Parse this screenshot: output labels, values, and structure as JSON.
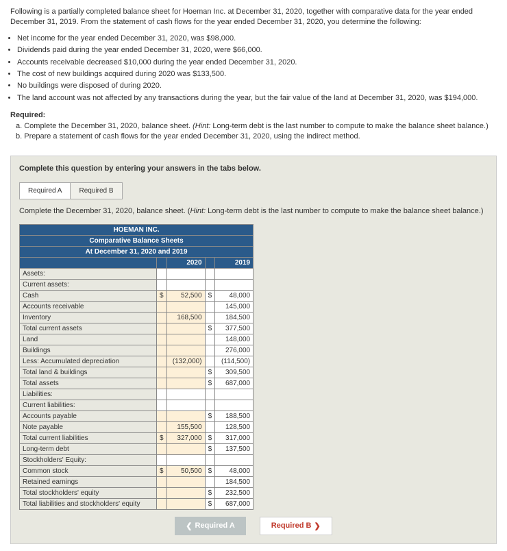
{
  "intro": "Following is a partially completed balance sheet for Hoeman Inc. at December 31, 2020, together with comparative data for the year ended December 31, 2019. From the statement of cash flows for the year ended December 31, 2020, you determine the following:",
  "bullets": [
    "Net income for the year ended December 31, 2020, was $98,000.",
    "Dividends paid during the year ended December 31, 2020, were $66,000.",
    "Accounts receivable decreased $10,000 during the year ended December 31, 2020.",
    "The cost of new buildings acquired during 2020 was $133,500.",
    "No buildings were disposed of during 2020.",
    "The land account was not affected by any transactions during the year, but the fair value of the land at December 31, 2020, was $194,000."
  ],
  "required": {
    "label": "Required:",
    "a_prefix": "a. ",
    "a_text": "Complete the December 31, 2020, balance sheet. ",
    "a_hint_prefix": "(Hint: ",
    "a_hint": "Long-term debt is the last number to compute to make the balance sheet balance.)",
    "b_prefix": "b. ",
    "b_text": "Prepare a statement of cash flows for the year ended December 31, 2020, using the indirect method."
  },
  "qbox": {
    "header": "Complete this question by entering your answers in the tabs below.",
    "tab_a": "Required A",
    "tab_b": "Required B",
    "tab_instr_1": "Complete the December 31, 2020, balance sheet. (",
    "tab_instr_hint_label": "Hint:",
    "tab_instr_2": " Long-term debt is the last number to compute to make the balance sheet balance.)"
  },
  "table": {
    "title1": "HOEMAN INC.",
    "title2": "Comparative Balance Sheets",
    "title3": "At December 31, 2020 and 2019",
    "y2020": "2020",
    "y2019": "2019",
    "rows": {
      "assets": "Assets:",
      "current_assets": "Current assets:",
      "cash": "Cash",
      "ar": "Accounts receivable",
      "inventory": "Inventory",
      "total_ca": "Total current assets",
      "land": "Land",
      "buildings": "Buildings",
      "less_dep": "Less: Accumulated depreciation",
      "total_lb": "Total land & buildings",
      "total_assets": "Total assets",
      "liabilities": "Liabilities:",
      "current_liab": "Current liabilities:",
      "ap": "Accounts payable",
      "np": "Note payable",
      "total_cl": "Total current liabilities",
      "ltd": "Long-term debt",
      "se": "Stockholders' Equity:",
      "cs": "Common stock",
      "re": "Retained earnings",
      "total_se": "Total stockholders' equity",
      "total_lse": "Total liabilities and stockholders' equity"
    },
    "vals2020": {
      "cash_d": "$",
      "cash": "52,500",
      "inventory": "168,500",
      "less_dep": "(132,000)",
      "np": "155,500",
      "total_cl_d": "$",
      "total_cl": "327,000",
      "cs_d": "$",
      "cs": "50,500"
    },
    "vals2019": {
      "cash_d": "$",
      "cash": "48,000",
      "ar": "145,000",
      "inventory": "184,500",
      "total_ca_d": "$",
      "total_ca": "377,500",
      "land": "148,000",
      "buildings": "276,000",
      "less_dep": "(114,500)",
      "total_lb_d": "$",
      "total_lb": "309,500",
      "total_assets_d": "$",
      "total_assets": "687,000",
      "ap_d": "$",
      "ap": "188,500",
      "np": "128,500",
      "total_cl_d": "$",
      "total_cl": "317,000",
      "ltd_d": "$",
      "ltd": "137,500",
      "cs_d": "$",
      "cs": "48,000",
      "re": "184,500",
      "total_se_d": "$",
      "total_se": "232,500",
      "total_lse_d": "$",
      "total_lse": "687,000"
    }
  },
  "nav": {
    "prev": "Required A",
    "next": "Required B"
  }
}
